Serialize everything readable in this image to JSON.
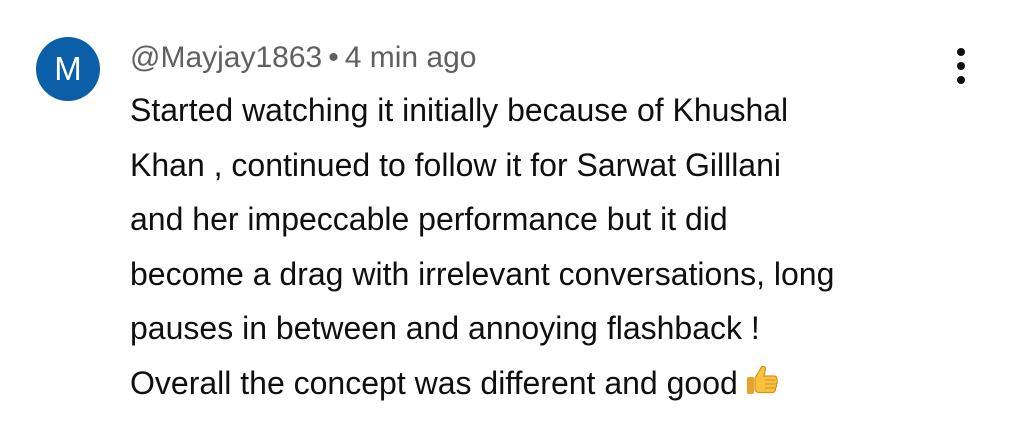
{
  "comment": {
    "avatar_letter": "M",
    "avatar_color": "#0b5ea8",
    "username": "@Mayjay1863",
    "separator": "•",
    "time_ago": "4 min ago",
    "more_icon": "more-vert-icon",
    "text_lines": [
      "Started watching it initially because of Khushal",
      "Khan , continued to follow it for Sarwat Gilllani",
      "and her impeccable performance but it did",
      "become a drag with irrelevant conversations, long",
      "pauses in between and annoying flashback !",
      "Overall the concept was different and good"
    ],
    "emoji": "thumbs-up-icon"
  }
}
